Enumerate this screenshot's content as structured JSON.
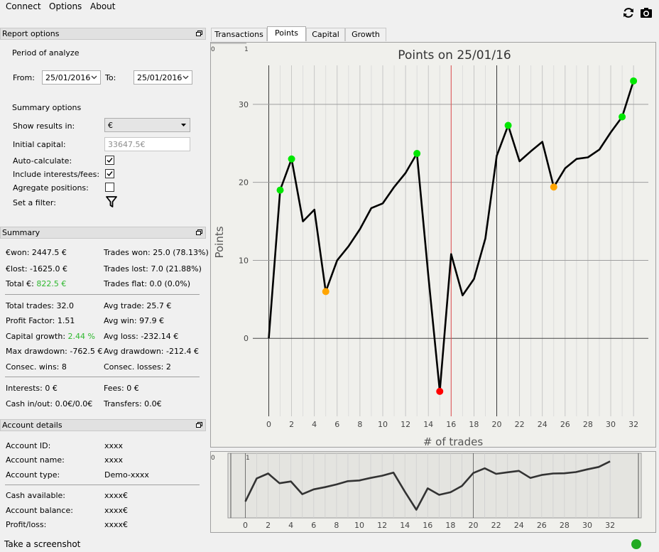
{
  "menu": {
    "connect": "Connect",
    "options": "Options",
    "about": "About"
  },
  "toolbar_icons": [
    "refresh-icon",
    "camera-icon"
  ],
  "report_options": {
    "title": "Report options",
    "period_label": "Period of analyze",
    "from_label": "From:",
    "from_value": "25/01/2016",
    "to_label": "To:",
    "to_value": "25/01/2016",
    "summary_options_label": "Summary options",
    "show_results_label": "Show results in:",
    "show_results_value": "€",
    "initial_capital_label": "Initial capital:",
    "initial_capital_value": "33647.5€",
    "auto_calculate_label": "Auto-calculate:",
    "auto_calculate_checked": true,
    "include_interests_label": "Include interests/fees:",
    "include_interests_checked": true,
    "aggregate_label": "Agregate positions:",
    "aggregate_checked": false,
    "filter_label": "Set a filter:"
  },
  "summary": {
    "title": "Summary",
    "won": "€won: 2447.5 €",
    "lost": "€lost: -1625.0 €",
    "total_label": "Total €: ",
    "total_value": "822.5 €",
    "trades_won": "Trades won: 25.0 (78.13%)",
    "trades_lost": "Trades lost: 7.0 (21.88%)",
    "trades_flat": "Trades flat: 0.0 (0.0%)",
    "total_trades": "Total trades: 32.0",
    "profit_factor": "Profit Factor: 1.51",
    "capital_growth_label": "Capital growth: ",
    "capital_growth_value": "2.44 %",
    "max_drawdown": "Max drawdown: -762.5 €",
    "consec_wins": "Consec. wins: 8",
    "avg_trade": "Avg trade: 25.7 €",
    "avg_win": "Avg win: 97.9 €",
    "avg_loss": "Avg loss: -232.14 €",
    "avg_drawdown": "Avg drawdown: -212.4 €",
    "consec_losses": "Consec. losses: 2",
    "interests": "Interests: 0 €",
    "fees": "Fees: 0 €",
    "cash_inout": "Cash in/out: 0.0€/0.0€",
    "transfers": "Transfers: 0.0€"
  },
  "account": {
    "title": "Account details",
    "id_label": "Account ID:",
    "id_value": "xxxx",
    "name_label": "Account name:",
    "name_value": "xxxx",
    "type_label": "Account type:",
    "type_value": "Demo-xxxx",
    "cash_label": "Cash available:",
    "cash_value": "xxxx€",
    "balance_label": "Account balance:",
    "balance_value": "xxxx€",
    "pl_label": "Profit/loss:",
    "pl_value": "xxxx€"
  },
  "tabs": [
    {
      "label": "Transactions",
      "active": false
    },
    {
      "label": "Points",
      "active": true
    },
    {
      "label": "Capital",
      "active": false
    },
    {
      "label": "Growth",
      "active": false
    }
  ],
  "status": {
    "text": "Take a screenshot",
    "indicator_color": "#22aa22"
  },
  "colors": {
    "line": "#000000",
    "win_marker": "#00e600",
    "mid_marker": "#ffa500",
    "loss_marker": "#ff0000",
    "vline": "#e05050"
  },
  "chart_data": {
    "type": "line",
    "title": "Points on 25/01/16",
    "xlabel": "# of trades",
    "ylabel": "Points",
    "xlim": [
      -1.4,
      33.3
    ],
    "ylim": [
      -10,
      35
    ],
    "xticks": [
      0,
      2,
      4,
      6,
      8,
      10,
      12,
      14,
      16,
      18,
      20,
      22,
      24,
      26,
      28,
      30,
      32
    ],
    "yticks": [
      0,
      10,
      20,
      30
    ],
    "corner_labels": [
      "0",
      "1"
    ],
    "vline_x": 16,
    "x": [
      0,
      1,
      2,
      3,
      4,
      5,
      6,
      7,
      8,
      9,
      10,
      11,
      12,
      13,
      14,
      15,
      16,
      17,
      18,
      19,
      20,
      21,
      22,
      23,
      24,
      25,
      26,
      27,
      28,
      29,
      30,
      31,
      32
    ],
    "y": [
      0,
      19,
      23,
      15,
      16.5,
      6,
      10,
      11.8,
      14,
      16.7,
      17.3,
      19.4,
      21.2,
      23.7,
      8,
      -6.8,
      10.8,
      5.5,
      7.6,
      12.8,
      23.4,
      27.3,
      22.7,
      24,
      25.2,
      19.4,
      21.8,
      23,
      23.2,
      24.2,
      26.4,
      28.4,
      33
    ],
    "markers": [
      {
        "x": 1,
        "kind": "win"
      },
      {
        "x": 2,
        "kind": "win"
      },
      {
        "x": 5,
        "kind": "mid"
      },
      {
        "x": 13,
        "kind": "win"
      },
      {
        "x": 15,
        "kind": "loss"
      },
      {
        "x": 21,
        "kind": "win"
      },
      {
        "x": 25,
        "kind": "mid"
      },
      {
        "x": 31,
        "kind": "win"
      },
      {
        "x": 32,
        "kind": "win"
      }
    ],
    "grid": true
  }
}
